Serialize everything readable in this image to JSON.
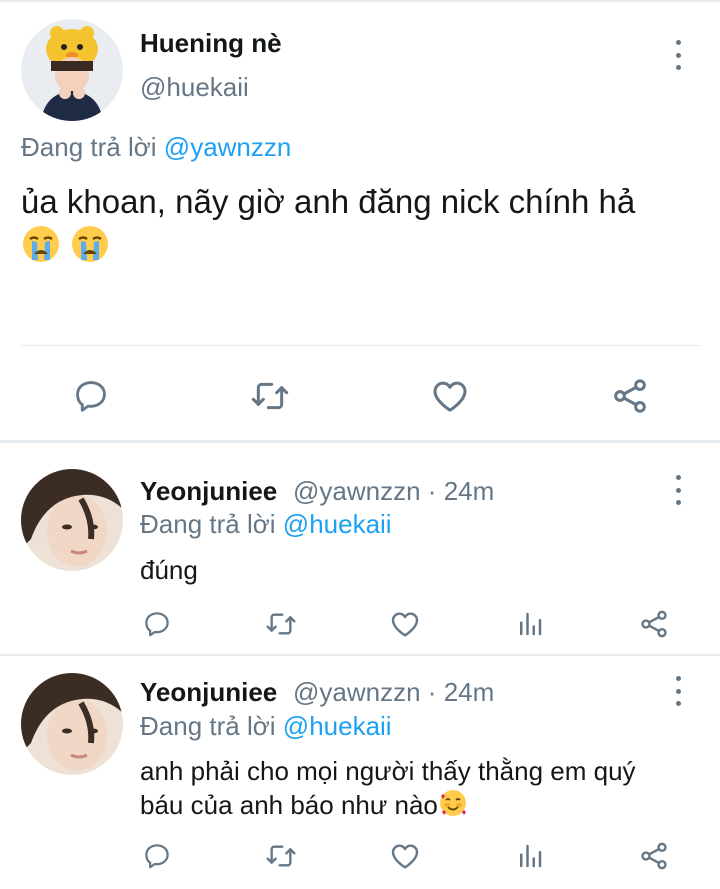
{
  "main_tweet": {
    "display_name": "Huening nè",
    "handle": "@huekaii",
    "reply_prefix": "Đang trả lời",
    "reply_to": "@yawnzzn",
    "text": "ủa khoan, nãy giờ anh đăng nick chính hả",
    "emoji": [
      "loudly-crying-face-emoji",
      "loudly-crying-face-emoji"
    ]
  },
  "replies": [
    {
      "display_name": "Yeonjuniee",
      "handle": "@yawnzzn",
      "separator": "·",
      "time": "24m",
      "reply_prefix": "Đang trả lời",
      "reply_to": "@huekaii",
      "text": "đúng"
    },
    {
      "display_name": "Yeonjuniee",
      "handle": "@yawnzzn",
      "separator": "·",
      "time": "24m",
      "reply_prefix": "Đang trả lời",
      "reply_to": "@huekaii",
      "text_line1": "anh phải cho mọi người thấy thằng em quý",
      "text_line2": "báu của anh báo như nào",
      "emoji": "smiling-face-with-hearts-emoji"
    }
  ],
  "icons": {
    "reply": "reply-icon",
    "retweet": "retweet-icon",
    "like": "heart-icon",
    "analytics": "analytics-icon",
    "share": "share-icon",
    "more": "more-options-icon"
  },
  "colors": {
    "text": "#14171a",
    "secondary": "#657786",
    "mention": "#1da1f2",
    "divider": "#e6ecf0"
  }
}
